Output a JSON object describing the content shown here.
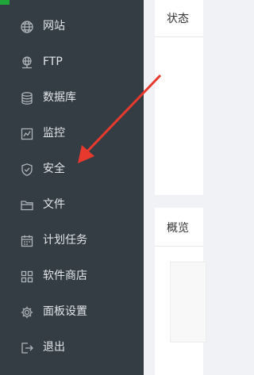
{
  "sidebar": {
    "items": [
      {
        "label": "网站",
        "icon": "globe-icon"
      },
      {
        "label": "FTP",
        "icon": "ftp-icon"
      },
      {
        "label": "数据库",
        "icon": "database-icon"
      },
      {
        "label": "监控",
        "icon": "monitor-chart-icon"
      },
      {
        "label": "安全",
        "icon": "shield-icon"
      },
      {
        "label": "文件",
        "icon": "folder-icon"
      },
      {
        "label": "计划任务",
        "icon": "calendar-icon"
      },
      {
        "label": "软件商店",
        "icon": "grid-apps-icon"
      },
      {
        "label": "面板设置",
        "icon": "gear-icon"
      },
      {
        "label": "退出",
        "icon": "logout-icon"
      }
    ]
  },
  "main": {
    "status_title": "状态",
    "overview_title": "概览"
  },
  "colors": {
    "sidebar_bg": "#343d44",
    "accent": "#20a53a",
    "arrow": "#e8392f"
  }
}
